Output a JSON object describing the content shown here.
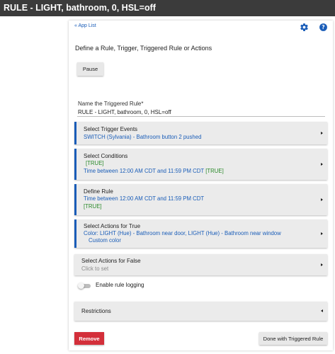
{
  "window": {
    "title": "RULE - LIGHT, bathroom, 0, HSL=off"
  },
  "nav": {
    "app_list_link": "« App List",
    "settings_icon": "gear-icon",
    "help_icon": "help-icon"
  },
  "page": {
    "heading": "Define a Rule, Trigger, Triggered Rule or Actions",
    "pause_label": "Pause",
    "name_label": "Name the Triggered Rule*",
    "name_value": "RULE - LIGHT, bathroom, 0, HSL=off"
  },
  "sections": {
    "trigger": {
      "title": "Select Trigger Events",
      "line1": "SWITCH (Sylvania) - Bathroom button 2 pushed"
    },
    "conditions": {
      "title": "Select Conditions",
      "line1": "[TRUE]",
      "line2": "Time between 12:00 AM CDT and 11:59 PM CDT",
      "line2_status": "[TRUE]"
    },
    "define": {
      "title": "Define Rule",
      "line1": "Time between 12:00 AM CDT and 11:59 PM CDT",
      "line2": "[TRUE]"
    },
    "actions_true": {
      "title": "Select Actions for True",
      "line1": "Color: LIGHT (Hue) - Bathroom near door, LIGHT (Hue) - Bathroom near window",
      "line2": "Custom color"
    },
    "actions_false": {
      "title": "Select Actions for False",
      "line1": "Click to set"
    },
    "restrictions": {
      "title": "Restrictions"
    }
  },
  "logging": {
    "label": "Enable rule logging",
    "enabled": false
  },
  "footer": {
    "remove_label": "Remove",
    "done_label": "Done with Triggered Rule"
  },
  "colors": {
    "accent": "#1a5db8",
    "true_status": "#2a8a2a",
    "remove": "#d32f3a",
    "titlebar": "#3b3b3b"
  }
}
